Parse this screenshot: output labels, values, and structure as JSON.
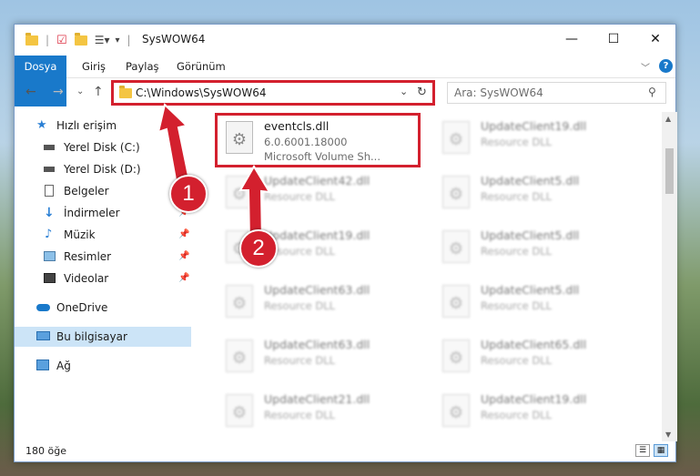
{
  "window": {
    "title": "SysWOW64",
    "controls": {
      "minimize": "—",
      "maximize": "☐",
      "close": "✕"
    }
  },
  "ribbon": {
    "tabs": [
      "Dosya",
      "Giriş",
      "Paylaş",
      "Görünüm"
    ]
  },
  "address": {
    "path": "C:\\Windows\\SysWOW64",
    "search_placeholder": "Ara: SysWOW64"
  },
  "nav": {
    "items": [
      {
        "label": "Hızlı erişim",
        "icon": "star-icon"
      },
      {
        "label": "Yerel Disk (C:)",
        "icon": "drive-icon"
      },
      {
        "label": "Yerel Disk (D:)",
        "icon": "drive-icon"
      },
      {
        "label": "Belgeler",
        "icon": "document-icon"
      },
      {
        "label": "İndirmeler",
        "icon": "download-icon"
      },
      {
        "label": "Müzik",
        "icon": "music-icon"
      },
      {
        "label": "Resimler",
        "icon": "pictures-icon"
      },
      {
        "label": "Videolar",
        "icon": "video-icon"
      },
      {
        "label": "OneDrive",
        "icon": "cloud-icon"
      },
      {
        "label": "Bu bilgisayar",
        "icon": "computer-icon"
      },
      {
        "label": "Ağ",
        "icon": "network-icon"
      }
    ]
  },
  "files": [
    {
      "name": "eventcls.dll",
      "line1": "6.0.6001.18000",
      "line2": "Microsoft Volume Sh..."
    },
    {
      "name": "UpdateClient19.dll",
      "line1": "Resource DLL"
    },
    {
      "name": "UpdateClient42.dll",
      "line1": "Resource DLL"
    },
    {
      "name": "UpdateClient5.dll",
      "line1": "Resource DLL"
    },
    {
      "name": "UpdateClient19.dll",
      "line1": "Resource DLL"
    },
    {
      "name": "UpdateClient5.dll",
      "line1": "Resource DLL"
    },
    {
      "name": "UpdateClient63.dll",
      "line1": "Resource DLL"
    },
    {
      "name": "UpdateClient5.dll",
      "line1": "Resource DLL"
    },
    {
      "name": "UpdateClient63.dll",
      "line1": "Resource DLL"
    },
    {
      "name": "UpdateClient65.dll",
      "line1": "Resource DLL"
    },
    {
      "name": "UpdateClient21.dll",
      "line1": "Resource DLL"
    },
    {
      "name": "UpdateClient19.dll",
      "line1": "Resource DLL"
    }
  ],
  "status": {
    "count": "180 öğe"
  },
  "annotations": {
    "badge1": "1",
    "badge2": "2"
  },
  "colors": {
    "accent": "#1979ca",
    "highlight": "#d3202e",
    "selected": "#cce4f7"
  }
}
